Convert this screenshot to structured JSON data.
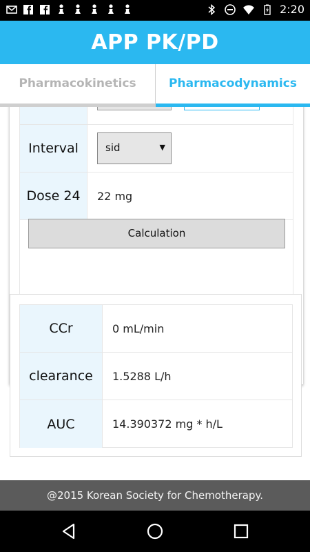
{
  "status_bar": {
    "time": "2:20",
    "left_icons": [
      "mail-icon",
      "facebook-icon",
      "facebook-icon",
      "chess-pawn-icon",
      "chess-pawn-icon",
      "chess-pawn-icon",
      "chess-pawn-icon",
      "chess-pawn-icon"
    ],
    "right_icons": [
      "bluetooth-icon",
      "do-not-disturb-icon",
      "wifi-icon",
      "battery-charging-icon"
    ]
  },
  "app_bar": {
    "title": "APP PK/PD"
  },
  "tabs": [
    {
      "label": "Pharmacokinetics",
      "selected": false
    },
    {
      "label": "Pharmacodynamics",
      "selected": true
    }
  ],
  "form": {
    "interval": {
      "label": "Interval",
      "value": "sid"
    },
    "dose24": {
      "label": "Dose 24",
      "value": "22 mg"
    },
    "calc_button": "Calculation"
  },
  "results": [
    {
      "label": "CCr",
      "value": "0 mL/min"
    },
    {
      "label": "clearance",
      "value": "1.5288 L/h"
    },
    {
      "label": "AUC",
      "value": "14.390372 mg * h/L"
    }
  ],
  "footer": {
    "text": "@2015 Korean Society for Chemotherapy."
  },
  "nav": [
    "back-icon",
    "home-icon",
    "recents-icon"
  ],
  "colors": {
    "primary": "#2bb8f0",
    "label_bg": "#eaf6fd",
    "footer_bg": "#5b5b5b"
  }
}
